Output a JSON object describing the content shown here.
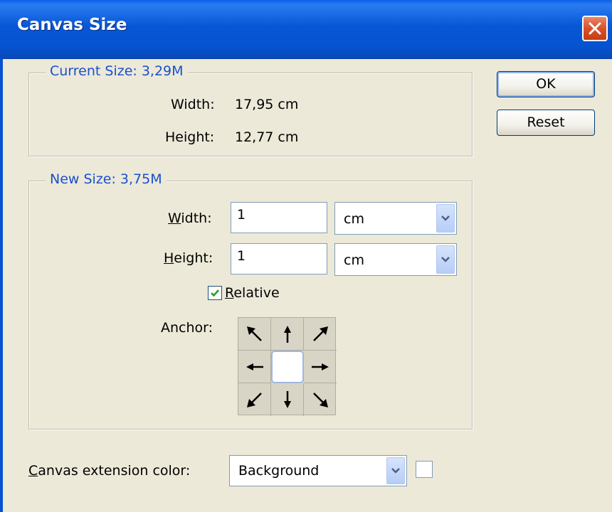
{
  "window": {
    "title": "Canvas Size"
  },
  "buttons": {
    "ok": "OK",
    "reset": "Reset"
  },
  "current_size": {
    "legend": "Current Size: 3,29M",
    "width_label": "Width:",
    "width_value": "17,95 cm",
    "height_label": "Height:",
    "height_value": "12,77 cm"
  },
  "new_size": {
    "legend": "New Size: 3,75M",
    "width_label_first": "W",
    "width_label_rest": "idth:",
    "width_value": "1",
    "width_unit": "cm",
    "height_label_first": "H",
    "height_label_rest": "eight:",
    "height_value": "1",
    "height_unit": "cm",
    "relative_label_first": "R",
    "relative_label_rest": "elative",
    "relative_checked": true,
    "anchor_label": "Anchor:"
  },
  "extension": {
    "label_first": "C",
    "label_rest": "anvas extension color:",
    "value": "Background",
    "swatch_color": "#ffffff"
  },
  "colors": {
    "accent": "#1a4fce",
    "titlebar": "#0553d0"
  },
  "icons": {
    "close": "close-icon",
    "dropdown": "chevron-down-icon",
    "check": "check-icon"
  }
}
